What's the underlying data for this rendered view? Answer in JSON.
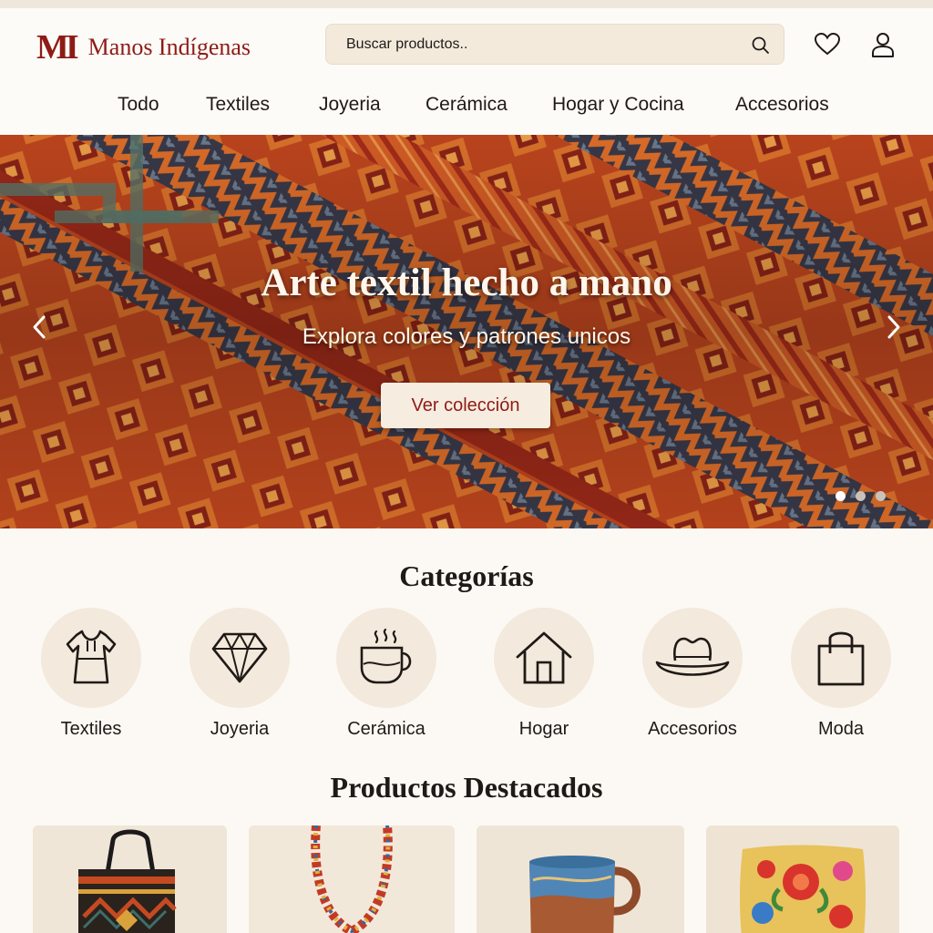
{
  "brand": {
    "mark": "MI",
    "name": "Manos Indígenas"
  },
  "search": {
    "placeholder": "Buscar productos.."
  },
  "header_icons": [
    "search-icon",
    "heart-icon",
    "user-icon"
  ],
  "nav": [
    "Todo",
    "Textiles",
    "Joyeria",
    "Cerámica",
    "Hogar y Cocina",
    "Accesorios"
  ],
  "hero": {
    "title": "Arte textil hecho a mano",
    "subtitle": "Explora colores y patrones unicos",
    "cta": "Ver colección",
    "active_slide": 1,
    "slides": 3
  },
  "categories": {
    "title": "Categorías",
    "items": [
      {
        "label": "Textiles",
        "icon": "dress-icon"
      },
      {
        "label": "Joyeria",
        "icon": "diamond-icon"
      },
      {
        "label": "Cerámica",
        "icon": "cup-icon"
      },
      {
        "label": "Hogar",
        "icon": "house-icon"
      },
      {
        "label": "Accesorios",
        "icon": "hat-icon"
      },
      {
        "label": "Moda",
        "icon": "shopping-bag-icon"
      }
    ]
  },
  "featured": {
    "title": "Productos Destacados",
    "products": [
      "woven-tote-bag",
      "beaded-necklace",
      "ceramic-mug",
      "embroidered-pillow"
    ]
  },
  "colors": {
    "brand": "#8e1b16",
    "background": "#fcf9f4",
    "chip": "#f3e9dc"
  }
}
